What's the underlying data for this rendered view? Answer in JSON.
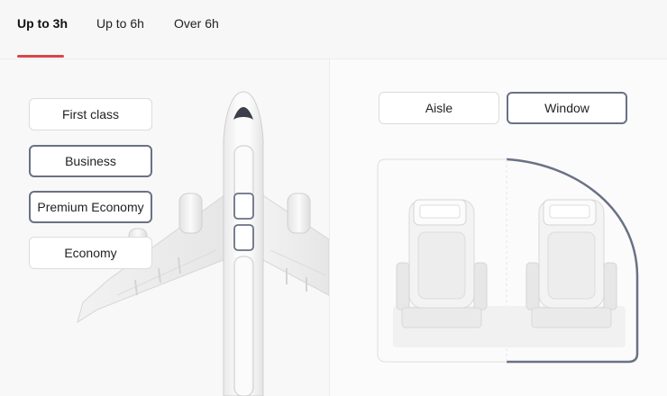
{
  "tabs": [
    {
      "label": "Up to 3h",
      "active": true
    },
    {
      "label": "Up to 6h",
      "active": false
    },
    {
      "label": "Over 6h",
      "active": false
    }
  ],
  "cabin_classes": [
    {
      "label": "First class",
      "selected": false
    },
    {
      "label": "Business",
      "selected": true
    },
    {
      "label": "Premium Economy",
      "selected": true
    },
    {
      "label": "Economy",
      "selected": false
    }
  ],
  "seat_positions": [
    {
      "label": "Aisle",
      "selected": false
    },
    {
      "label": "Window",
      "selected": true
    }
  ],
  "colors": {
    "accent": "#d9454a",
    "selected_border": "#6a7186",
    "fuselage_outline": "#c9c9c9"
  }
}
